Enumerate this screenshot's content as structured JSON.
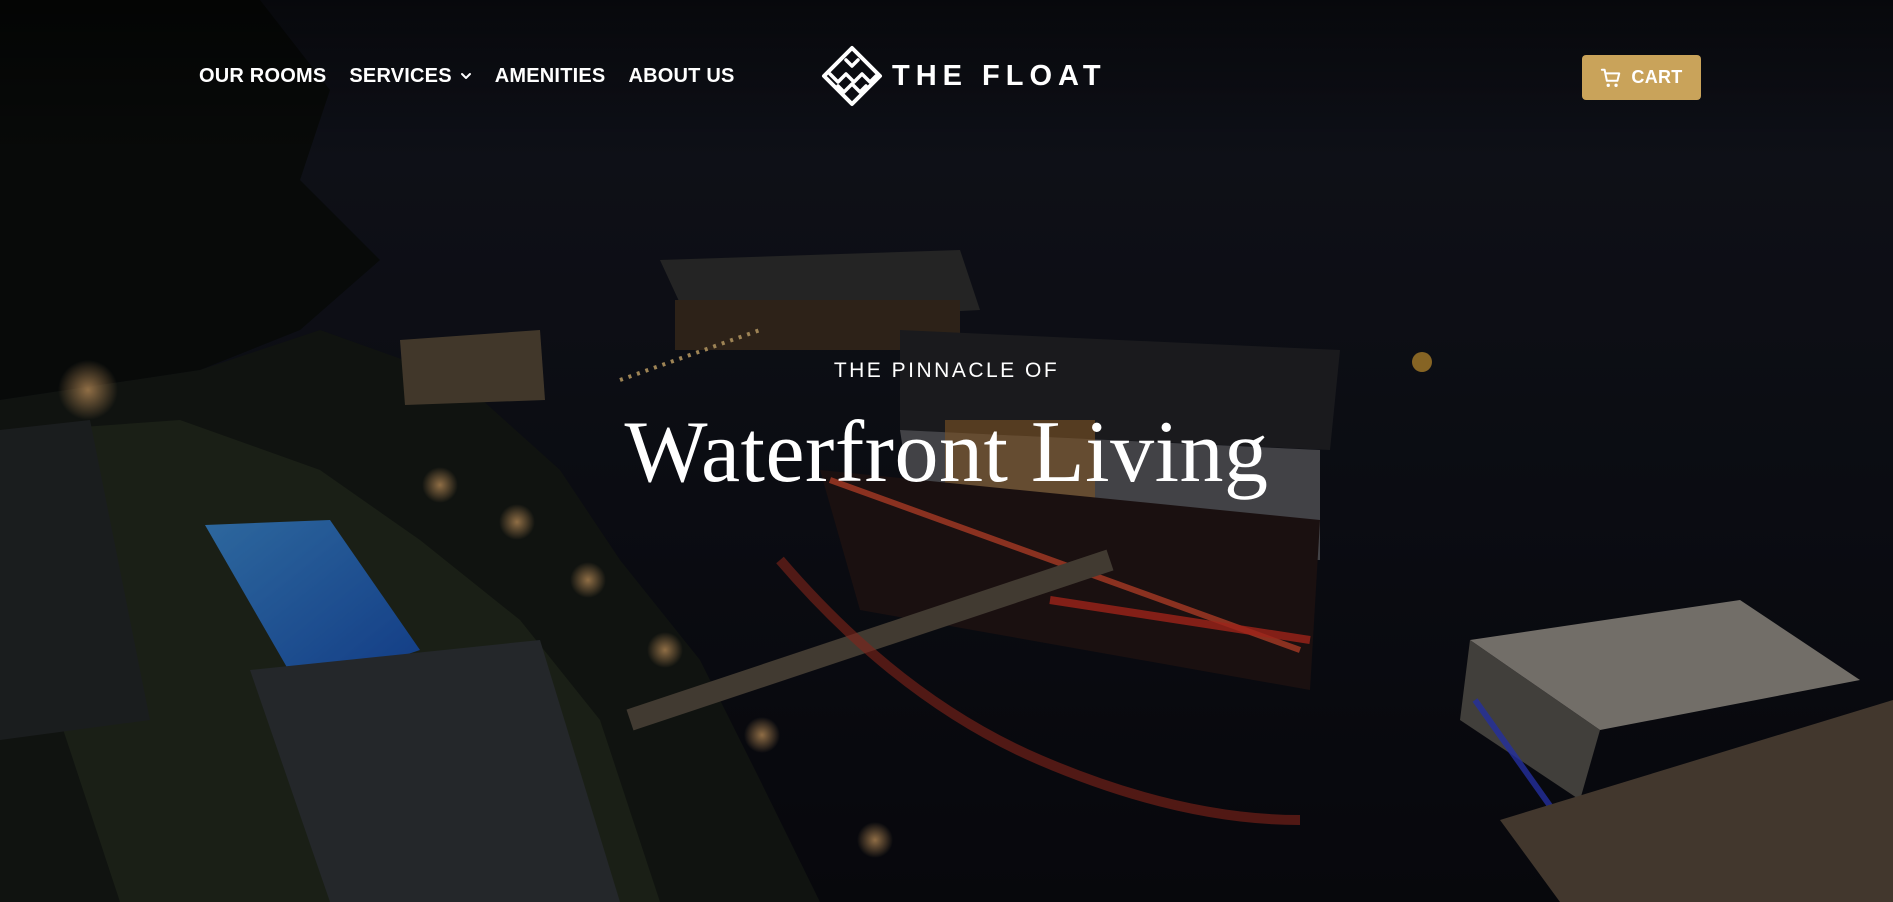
{
  "nav": {
    "items": [
      {
        "label": "OUR ROOMS"
      },
      {
        "label": "SERVICES"
      },
      {
        "label": "AMENITIES"
      },
      {
        "label": "ABOUT US"
      }
    ]
  },
  "logo": {
    "text": "THE FLOAT"
  },
  "cart": {
    "label": "CART",
    "icon": "cart-icon"
  },
  "hero": {
    "kicker": "THE PINNACLE OF",
    "title": "Waterfront Living"
  },
  "colors": {
    "accent": "#c9a35a",
    "text": "#ffffff",
    "overlay": "#0b0d12"
  }
}
